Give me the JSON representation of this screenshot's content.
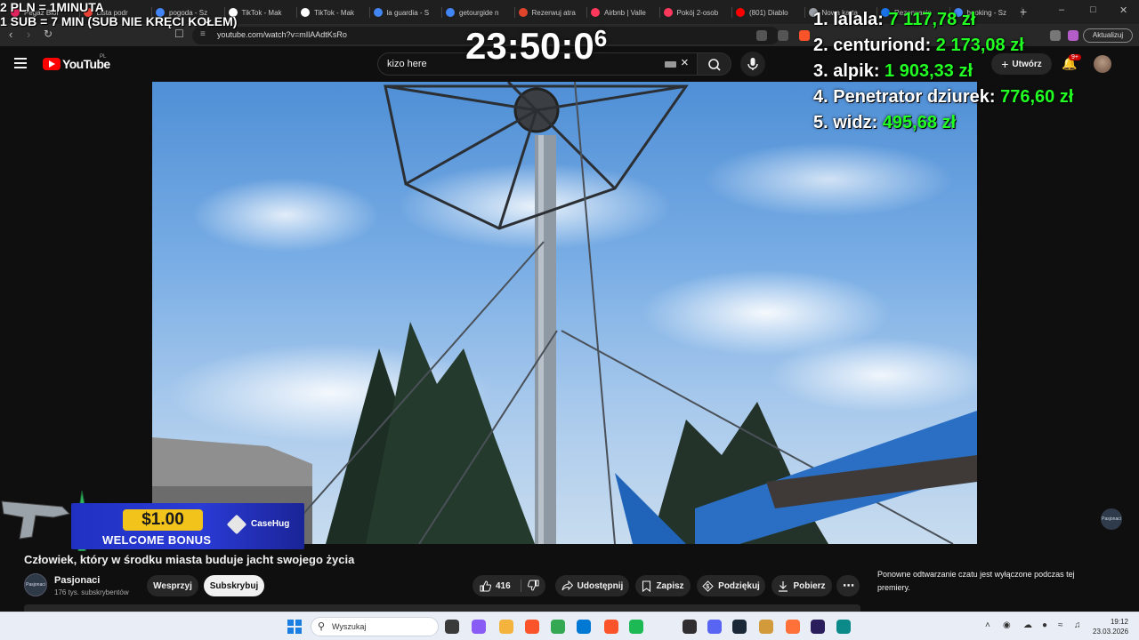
{
  "browser": {
    "tabs": [
      {
        "label": "Pegaz Biof",
        "color": "#e0245e"
      },
      {
        "label": "Lista podr",
        "color": "#ea4335"
      },
      {
        "label": "pogoda - Sz",
        "color": "#4285f4"
      },
      {
        "label": "TikTok - Mak",
        "color": "#ffffff"
      },
      {
        "label": "TikTok - Mak",
        "color": "#ffffff"
      },
      {
        "label": "la guardia - S",
        "color": "#4285f4"
      },
      {
        "label": "getourgide n",
        "color": "#4285f4"
      },
      {
        "label": "Rezerwuj atra",
        "color": "#e0452c"
      },
      {
        "label": "Airbnb | Valle",
        "color": "#ff385c"
      },
      {
        "label": "Pokój 2-osob",
        "color": "#ff385c"
      },
      {
        "label": "(801) Diablo",
        "color": "#ff0000"
      },
      {
        "label": "Nowa karta",
        "color": "#9aa0a6"
      },
      {
        "label": "Rezerwacje",
        "color": "#1a73e8"
      },
      {
        "label": "booking - Sz",
        "color": "#4285f4"
      }
    ],
    "url": "youtube.com/watch?v=mIlAAdtKsRo",
    "update_button": "Aktualizuj"
  },
  "youtube": {
    "logo_text": "YouTube",
    "country": "PL",
    "search_value": "kizo here",
    "create_label": "Utwórz",
    "notifications_badge": "9+"
  },
  "overlay": {
    "donation_line1": "2 PLN =  1MINUTA",
    "donation_line2": "1 SUB = 7 MIN (SUB NIE KRĘCI KOŁEM)",
    "timer_main": "23:50:0",
    "timer_sup": "6",
    "leaderboard": [
      {
        "rank_name": "1. lalala:",
        "amount": "7 117,78 zł"
      },
      {
        "rank_name": "2. centuriond:",
        "amount": "2 173,08 zł"
      },
      {
        "rank_name": "3. alpik:",
        "amount": "1 903,33 zł"
      },
      {
        "rank_name": "4. Penetrator dziurek:",
        "amount": "776,60 zł"
      },
      {
        "rank_name": "5. widz:",
        "amount": "495,68 zł"
      }
    ]
  },
  "ad": {
    "amount": "$1.00",
    "bonus": "WELCOME BONUS",
    "brand": "CaseHug"
  },
  "video": {
    "watermark": "Pasjonaci",
    "title": "Człowiek, który w środku miasta buduje jacht swojego życia",
    "channel_name": "Pasjonaci",
    "channel_avatar_text": "Pasjonaci",
    "subscribers": "176 tys. subskrybentów",
    "support_label": "Wesprzyj",
    "subscribe_label": "Subskrybuj",
    "likes": "416",
    "share_label": "Udostępnij",
    "save_label": "Zapisz",
    "thanks_label": "Podziękuj",
    "download_label": "Pobierz",
    "chat_disabled_text": "Ponowne odtwarzanie czatu jest wyłączone podczas tej premiery."
  },
  "taskbar": {
    "search_placeholder": "Wyszukaj",
    "time": "19:12",
    "date": "23.03.2026",
    "apps": [
      {
        "name": "task-view",
        "color": "#3a3a3a"
      },
      {
        "name": "copilot",
        "color": "#8a5cf6"
      },
      {
        "name": "file-explorer",
        "color": "#f3b33d"
      },
      {
        "name": "brave",
        "color": "#fb542b"
      },
      {
        "name": "chrome",
        "color": "#34a853"
      },
      {
        "name": "store",
        "color": "#0078d4"
      },
      {
        "name": "brave-alt",
        "color": "#fb542b"
      },
      {
        "name": "spotify",
        "color": "#1db954"
      },
      {
        "name": "obs",
        "color": "#302e31"
      },
      {
        "name": "discord",
        "color": "#5865f2"
      },
      {
        "name": "steam",
        "color": "#1b2838"
      },
      {
        "name": "notepad",
        "color": "#d29a3a"
      },
      {
        "name": "firefox",
        "color": "#ff7139"
      },
      {
        "name": "premiere",
        "color": "#2a1e5c"
      },
      {
        "name": "edge",
        "color": "#0c8a8a"
      }
    ]
  }
}
